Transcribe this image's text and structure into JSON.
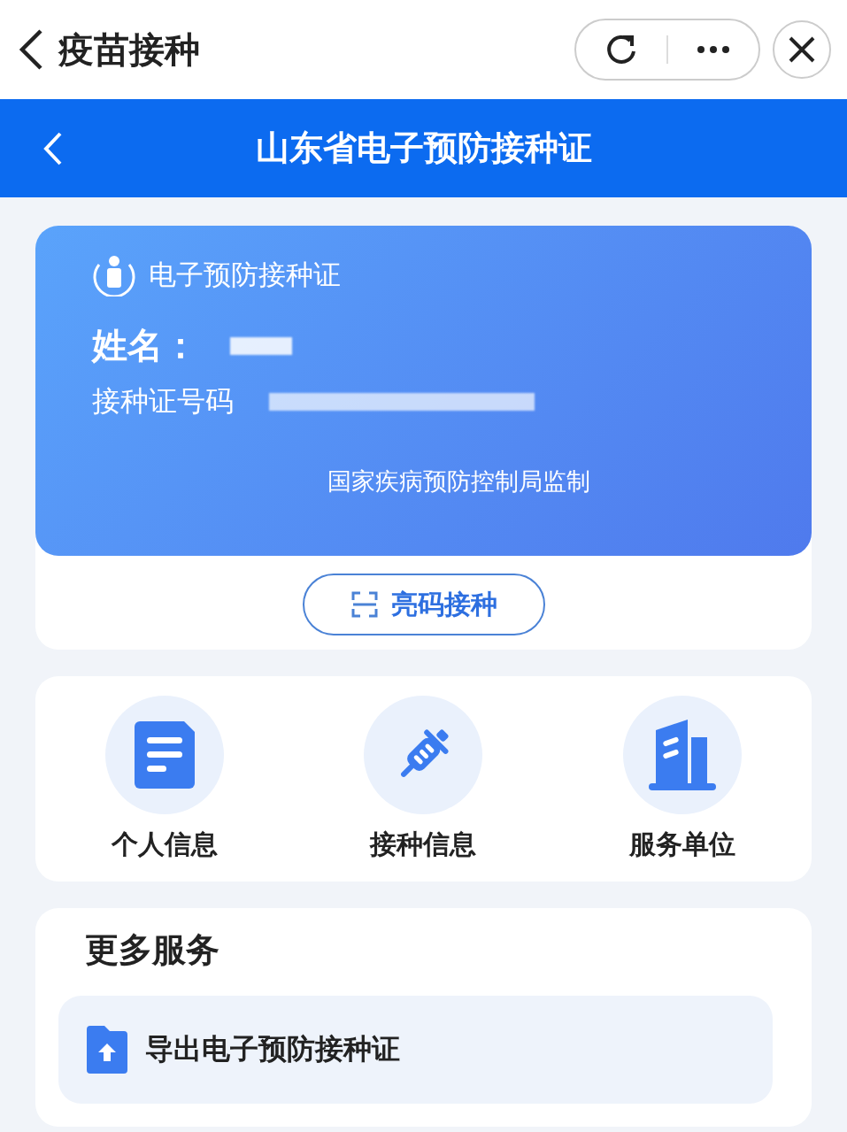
{
  "window": {
    "title": "疫苗接种"
  },
  "header": {
    "title": "山东省电子预防接种证"
  },
  "card": {
    "title": "电子预防接种证",
    "name_label": "姓名：",
    "number_label": "接种证号码",
    "supervisor": "国家疾病预防控制局监制",
    "button": "亮码接种"
  },
  "services": [
    {
      "kind": "document",
      "label": "个人信息"
    },
    {
      "kind": "syringe",
      "label": "接种信息"
    },
    {
      "kind": "building",
      "label": "服务单位"
    }
  ],
  "more": {
    "title": "更多服务",
    "items": [
      {
        "label": "导出电子预防接种证"
      }
    ]
  }
}
